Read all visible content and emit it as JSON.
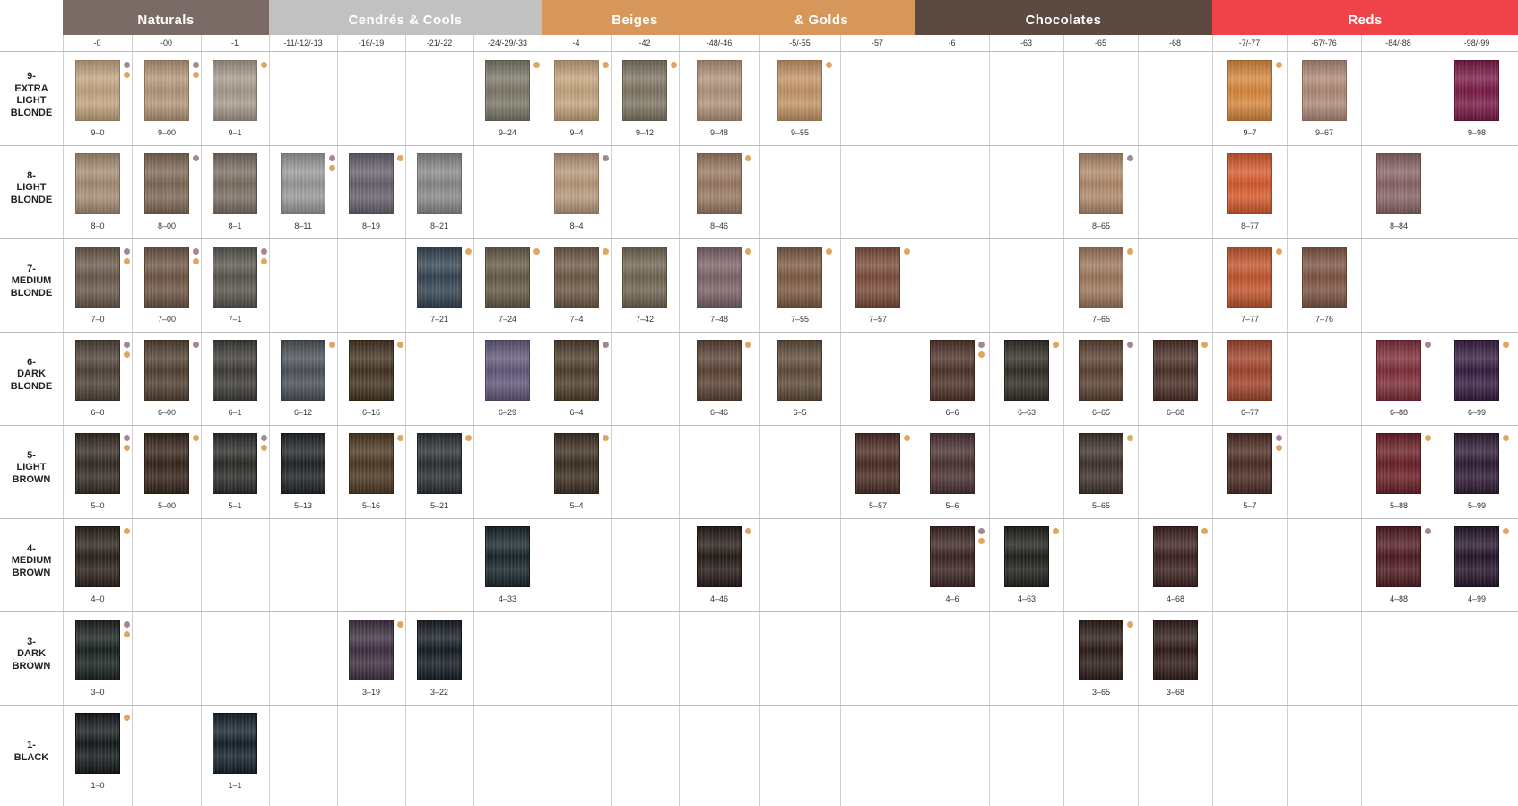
{
  "colors": {
    "ash_dot": "#a3898f",
    "gold_dot": "#e0a560",
    "grid_line": "#cfcfcf",
    "row_line": "#bdbdbd"
  },
  "families": [
    {
      "name": "Naturals",
      "labels": [
        "Naturals"
      ],
      "color": "#7a6b66",
      "start": 0,
      "span": 3
    },
    {
      "name": "Cendrés & Cools",
      "labels": [
        "Cendrés & Cools"
      ],
      "color": "#c1c1c1",
      "start": 3,
      "span": 4
    },
    {
      "name": "Beiges & Golds",
      "labels": [
        "Beiges",
        "& Golds"
      ],
      "color": "#d8975a",
      "start": 7,
      "span": 5
    },
    {
      "name": "Chocolates",
      "labels": [
        "Chocolates"
      ],
      "color": "#5c4a41",
      "start": 12,
      "span": 4
    },
    {
      "name": "Reds",
      "labels": [
        "Reds"
      ],
      "color": "#ef4249",
      "start": 16,
      "span": 4
    }
  ],
  "columns": [
    "-0",
    "-00",
    "-1",
    "-11/-12/-13",
    "-16/-19",
    "-21/-22",
    "-24/-29/-33",
    "-4",
    "-42",
    "-48/-46",
    "-5/-55",
    "-57",
    "-6",
    "-63",
    "-65",
    "-68",
    "-7/-77",
    "-67/-76",
    "-84/-88",
    "-98/-99"
  ],
  "rows": [
    {
      "label": [
        "9-",
        "EXTRA",
        "LIGHT",
        "BLONDE"
      ]
    },
    {
      "label": [
        "8-",
        "LIGHT",
        "BLONDE"
      ]
    },
    {
      "label": [
        "7-",
        "MEDIUM",
        "BLONDE"
      ]
    },
    {
      "label": [
        "6-",
        "DARK",
        "BLONDE"
      ]
    },
    {
      "label": [
        "5-",
        "LIGHT",
        "BROWN"
      ]
    },
    {
      "label": [
        "4-",
        "MEDIUM",
        "BROWN"
      ]
    },
    {
      "label": [
        "3-",
        "DARK",
        "BROWN"
      ]
    },
    {
      "label": [
        "1-",
        "BLACK"
      ]
    }
  ],
  "swatches": [
    {
      "row": 0,
      "col": 0,
      "code": "9–0",
      "color": "#c4a57f",
      "dots": [
        "ash",
        "gold"
      ]
    },
    {
      "row": 0,
      "col": 1,
      "code": "9–00",
      "color": "#b5977a",
      "dots": [
        "ash",
        "gold"
      ]
    },
    {
      "row": 0,
      "col": 2,
      "code": "9–1",
      "color": "#a89c8e",
      "dots": [
        "gold"
      ]
    },
    {
      "row": 0,
      "col": 6,
      "code": "9–24",
      "color": "#7c7868",
      "dots": [
        "gold"
      ]
    },
    {
      "row": 0,
      "col": 7,
      "code": "9–4",
      "color": "#c6a57d",
      "dots": [
        "gold"
      ]
    },
    {
      "row": 0,
      "col": 8,
      "code": "9–42",
      "color": "#7f7663",
      "dots": [
        "gold"
      ]
    },
    {
      "row": 0,
      "col": 9,
      "code": "9–48",
      "color": "#b3947c",
      "dots": []
    },
    {
      "row": 0,
      "col": 10,
      "code": "9–55",
      "color": "#c49566",
      "dots": [
        "gold"
      ]
    },
    {
      "row": 0,
      "col": 16,
      "code": "9–7",
      "color": "#d9873c",
      "dots": [
        "gold"
      ]
    },
    {
      "row": 0,
      "col": 17,
      "code": "9–67",
      "color": "#b08a78",
      "dots": []
    },
    {
      "row": 0,
      "col": 19,
      "code": "9–98",
      "color": "#7a1a45",
      "dots": []
    },
    {
      "row": 1,
      "col": 0,
      "code": "8–0",
      "color": "#a68d73",
      "dots": []
    },
    {
      "row": 1,
      "col": 1,
      "code": "8–00",
      "color": "#7e6a58",
      "dots": [
        "ash"
      ]
    },
    {
      "row": 1,
      "col": 2,
      "code": "8–1",
      "color": "#7a6f62",
      "dots": []
    },
    {
      "row": 1,
      "col": 3,
      "code": "8–11",
      "color": "#9a9a9c",
      "dots": [
        "ash",
        "gold"
      ]
    },
    {
      "row": 1,
      "col": 4,
      "code": "8–19",
      "color": "#68616c",
      "dots": [
        "gold"
      ]
    },
    {
      "row": 1,
      "col": 5,
      "code": "8–21",
      "color": "#8a8a8c",
      "dots": []
    },
    {
      "row": 1,
      "col": 7,
      "code": "8–4",
      "color": "#b8997a",
      "dots": [
        "ash"
      ]
    },
    {
      "row": 1,
      "col": 9,
      "code": "8–46",
      "color": "#9a7a62",
      "dots": [
        "gold"
      ]
    },
    {
      "row": 1,
      "col": 14,
      "code": "8–65",
      "color": "#b0896a",
      "dots": [
        "ash"
      ]
    },
    {
      "row": 1,
      "col": 16,
      "code": "8–77",
      "color": "#d85a2b",
      "dots": []
    },
    {
      "row": 1,
      "col": 18,
      "code": "8–84",
      "color": "#8a6566",
      "dots": []
    },
    {
      "row": 2,
      "col": 0,
      "code": "7–0",
      "color": "#6a5a4b",
      "dots": [
        "ash",
        "gold"
      ]
    },
    {
      "row": 2,
      "col": 1,
      "code": "7–00",
      "color": "#6e5645",
      "dots": [
        "ash",
        "gold"
      ]
    },
    {
      "row": 2,
      "col": 2,
      "code": "7–1",
      "color": "#5a5650",
      "dots": [
        "ash",
        "gold"
      ]
    },
    {
      "row": 2,
      "col": 5,
      "code": "7–21",
      "color": "#344452",
      "dots": [
        "gold"
      ]
    },
    {
      "row": 2,
      "col": 6,
      "code": "7–24",
      "color": "#665a47",
      "dots": [
        "gold"
      ]
    },
    {
      "row": 2,
      "col": 7,
      "code": "7–4",
      "color": "#6e5a46",
      "dots": [
        "gold"
      ]
    },
    {
      "row": 2,
      "col": 8,
      "code": "7–42",
      "color": "#716552",
      "dots": []
    },
    {
      "row": 2,
      "col": 9,
      "code": "7–48",
      "color": "#7c6468",
      "dots": [
        "gold"
      ]
    },
    {
      "row": 2,
      "col": 10,
      "code": "7–55",
      "color": "#7e5a42",
      "dots": [
        "gold"
      ]
    },
    {
      "row": 2,
      "col": 11,
      "code": "7–57",
      "color": "#7a4c3a",
      "dots": [
        "gold"
      ]
    },
    {
      "row": 2,
      "col": 14,
      "code": "7–65",
      "color": "#9e775b",
      "dots": [
        "gold"
      ]
    },
    {
      "row": 2,
      "col": 16,
      "code": "7–77",
      "color": "#c4552c",
      "dots": [
        "gold"
      ]
    },
    {
      "row": 2,
      "col": 17,
      "code": "7–76",
      "color": "#7e5442",
      "dots": []
    },
    {
      "row": 3,
      "col": 0,
      "code": "6–0",
      "color": "#4e4136",
      "dots": [
        "ash",
        "gold"
      ]
    },
    {
      "row": 3,
      "col": 1,
      "code": "6–00",
      "color": "#524032",
      "dots": [
        "ash"
      ]
    },
    {
      "row": 3,
      "col": 2,
      "code": "6–1",
      "color": "#3e3c38",
      "dots": []
    },
    {
      "row": 3,
      "col": 3,
      "code": "6–12",
      "color": "#4a5056",
      "dots": [
        "gold"
      ]
    },
    {
      "row": 3,
      "col": 4,
      "code": "6–16",
      "color": "#42321f",
      "dots": [
        "gold"
      ]
    },
    {
      "row": 3,
      "col": 6,
      "code": "6–29",
      "color": "#62587a",
      "dots": []
    },
    {
      "row": 3,
      "col": 7,
      "code": "6–4",
      "color": "#4e3e2c",
      "dots": [
        "ash"
      ]
    },
    {
      "row": 3,
      "col": 9,
      "code": "6–46",
      "color": "#5a4234",
      "dots": [
        "gold"
      ]
    },
    {
      "row": 3,
      "col": 10,
      "code": "6–5",
      "color": "#5e4a38",
      "dots": []
    },
    {
      "row": 3,
      "col": 12,
      "code": "6–6",
      "color": "#4e3228",
      "dots": [
        "ash",
        "gold"
      ]
    },
    {
      "row": 3,
      "col": 13,
      "code": "6–63",
      "color": "#302c24",
      "dots": [
        "gold"
      ]
    },
    {
      "row": 3,
      "col": 14,
      "code": "6–65",
      "color": "#5a4030",
      "dots": [
        "ash"
      ]
    },
    {
      "row": 3,
      "col": 15,
      "code": "6–68",
      "color": "#4a2e26",
      "dots": [
        "gold"
      ]
    },
    {
      "row": 3,
      "col": 16,
      "code": "6–77",
      "color": "#a2442a",
      "dots": []
    },
    {
      "row": 3,
      "col": 18,
      "code": "6–88",
      "color": "#7e2d38",
      "dots": [
        "ash"
      ]
    },
    {
      "row": 3,
      "col": 19,
      "code": "6–99",
      "color": "#351d40",
      "dots": [
        "gold"
      ]
    },
    {
      "row": 4,
      "col": 0,
      "code": "5–0",
      "color": "#332a22",
      "dots": [
        "ash",
        "gold"
      ]
    },
    {
      "row": 4,
      "col": 1,
      "code": "5–00",
      "color": "#34241a",
      "dots": [
        "gold"
      ]
    },
    {
      "row": 4,
      "col": 2,
      "code": "5–1",
      "color": "#2a2a28",
      "dots": [
        "ash",
        "gold"
      ]
    },
    {
      "row": 4,
      "col": 3,
      "code": "5–13",
      "color": "#1e2124",
      "dots": []
    },
    {
      "row": 4,
      "col": 4,
      "code": "5–16",
      "color": "#4c3620",
      "dots": [
        "gold"
      ]
    },
    {
      "row": 4,
      "col": 5,
      "code": "5–21",
      "color": "#2a2e30",
      "dots": [
        "gold"
      ]
    },
    {
      "row": 4,
      "col": 7,
      "code": "5–4",
      "color": "#3c2e20",
      "dots": [
        "gold"
      ]
    },
    {
      "row": 4,
      "col": 11,
      "code": "5–57",
      "color": "#4a2a22",
      "dots": [
        "gold"
      ]
    },
    {
      "row": 4,
      "col": 12,
      "code": "5–6",
      "color": "#4a3030",
      "dots": []
    },
    {
      "row": 4,
      "col": 14,
      "code": "5–65",
      "color": "#3e302a",
      "dots": [
        "gold"
      ]
    },
    {
      "row": 4,
      "col": 16,
      "code": "5–7",
      "color": "#4a2a20",
      "dots": [
        "ash",
        "gold"
      ]
    },
    {
      "row": 4,
      "col": 18,
      "code": "5–88",
      "color": "#6a1e26",
      "dots": [
        "gold"
      ]
    },
    {
      "row": 4,
      "col": 19,
      "code": "5–99",
      "color": "#2e1a34",
      "dots": [
        "gold"
      ]
    },
    {
      "row": 5,
      "col": 0,
      "code": "4–0",
      "color": "#2a201a",
      "dots": [
        "gold"
      ]
    },
    {
      "row": 5,
      "col": 6,
      "code": "4–33",
      "color": "#162428",
      "dots": []
    },
    {
      "row": 5,
      "col": 9,
      "code": "4–46",
      "color": "#241a16",
      "dots": [
        "gold"
      ]
    },
    {
      "row": 5,
      "col": 12,
      "code": "4–6",
      "color": "#3a2422",
      "dots": [
        "ash",
        "gold"
      ]
    },
    {
      "row": 5,
      "col": 13,
      "code": "4–63",
      "color": "#1e1e1a",
      "dots": [
        "gold"
      ]
    },
    {
      "row": 5,
      "col": 15,
      "code": "4–68",
      "color": "#3a201e",
      "dots": [
        "gold"
      ]
    },
    {
      "row": 5,
      "col": 18,
      "code": "4–88",
      "color": "#4e1a20",
      "dots": [
        "ash"
      ]
    },
    {
      "row": 5,
      "col": 19,
      "code": "4–99",
      "color": "#24142a",
      "dots": [
        "gold"
      ]
    },
    {
      "row": 6,
      "col": 0,
      "code": "3–0",
      "color": "#18201e",
      "dots": [
        "ash",
        "gold"
      ]
    },
    {
      "row": 6,
      "col": 4,
      "code": "3–19",
      "color": "#3e2e40",
      "dots": [
        "gold"
      ]
    },
    {
      "row": 6,
      "col": 5,
      "code": "3–22",
      "color": "#141c22",
      "dots": []
    },
    {
      "row": 6,
      "col": 14,
      "code": "3–65",
      "color": "#2a1a16",
      "dots": [
        "gold"
      ]
    },
    {
      "row": 6,
      "col": 15,
      "code": "3–68",
      "color": "#2e1a18",
      "dots": []
    },
    {
      "row": 7,
      "col": 0,
      "code": "1–0",
      "color": "#121818",
      "dots": [
        "gold"
      ]
    },
    {
      "row": 7,
      "col": 2,
      "code": "1–1",
      "color": "#14202a",
      "dots": []
    }
  ]
}
